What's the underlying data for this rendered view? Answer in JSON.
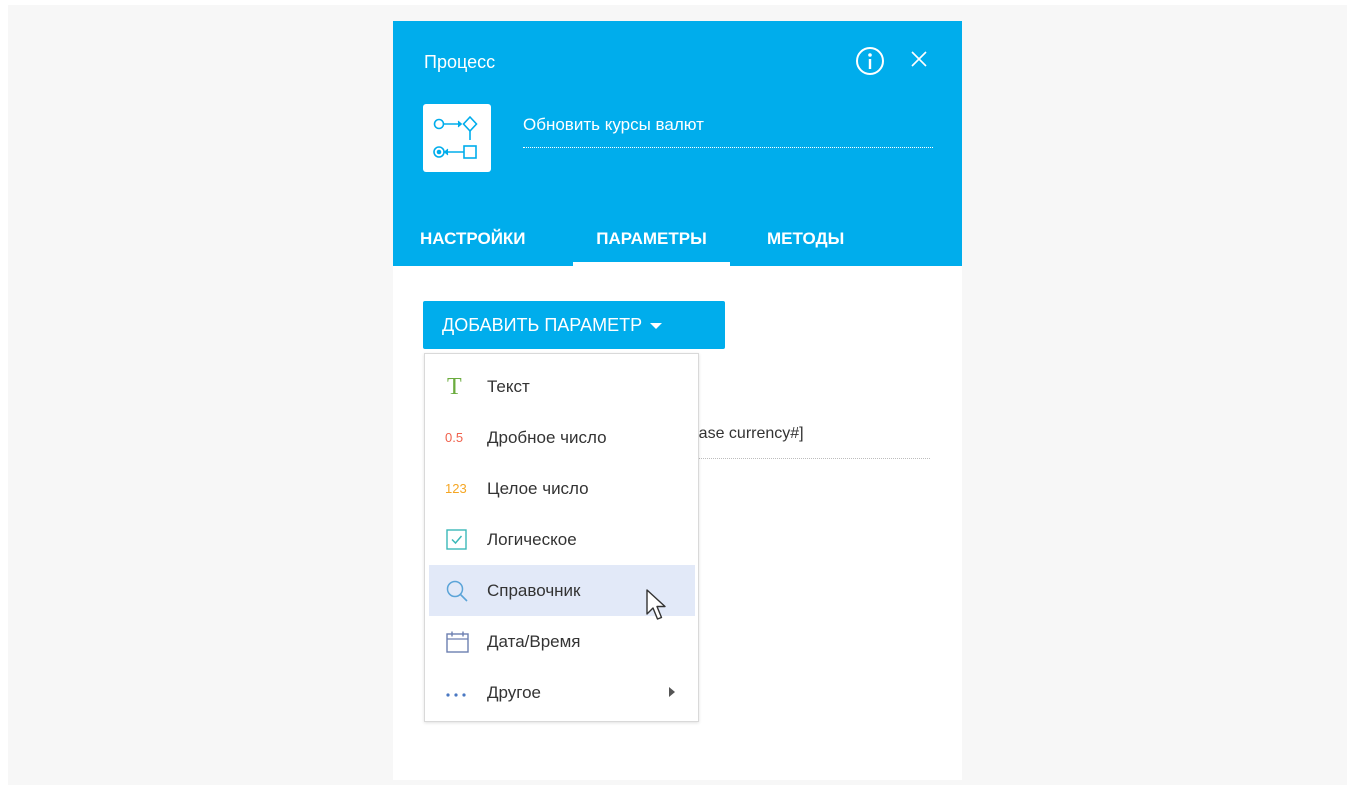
{
  "header": {
    "title": "Процесс",
    "process_name": "Обновить курсы валют",
    "info_icon": "info-icon",
    "close_icon": "close-icon"
  },
  "tabs": [
    {
      "label": "НАСТРОЙКИ",
      "active": false
    },
    {
      "label": "ПАРАМЕТРЫ",
      "active": true
    },
    {
      "label": "МЕТОДЫ",
      "active": false
    }
  ],
  "add_button": {
    "label": "ДОБАВИТЬ ПАРАМЕТР"
  },
  "field_fragment": "Base currency#]",
  "menu": {
    "items": [
      {
        "label": "Текст",
        "icon": "text-type-icon",
        "glyph": "T"
      },
      {
        "label": "Дробное число",
        "icon": "decimal-number-icon",
        "glyph": "0.5"
      },
      {
        "label": "Целое число",
        "icon": "integer-number-icon",
        "glyph": "123"
      },
      {
        "label": "Логическое",
        "icon": "checkbox-icon"
      },
      {
        "label": "Справочник",
        "icon": "search-icon"
      },
      {
        "label": "Дата/Время",
        "icon": "calendar-icon"
      },
      {
        "label": "Другое",
        "icon": "more-dots-icon"
      }
    ]
  },
  "colors": {
    "accent": "#00adec",
    "menu_hover": "#e2e9f8",
    "text_icon": "#6bac3f",
    "decimal_icon": "#f0624d",
    "integer_icon": "#f5a623",
    "boolean_icon": "#3bb8b8",
    "lookup_icon": "#5ba4d8",
    "date_icon": "#6d7fb0",
    "more_icon": "#4a78c2"
  }
}
